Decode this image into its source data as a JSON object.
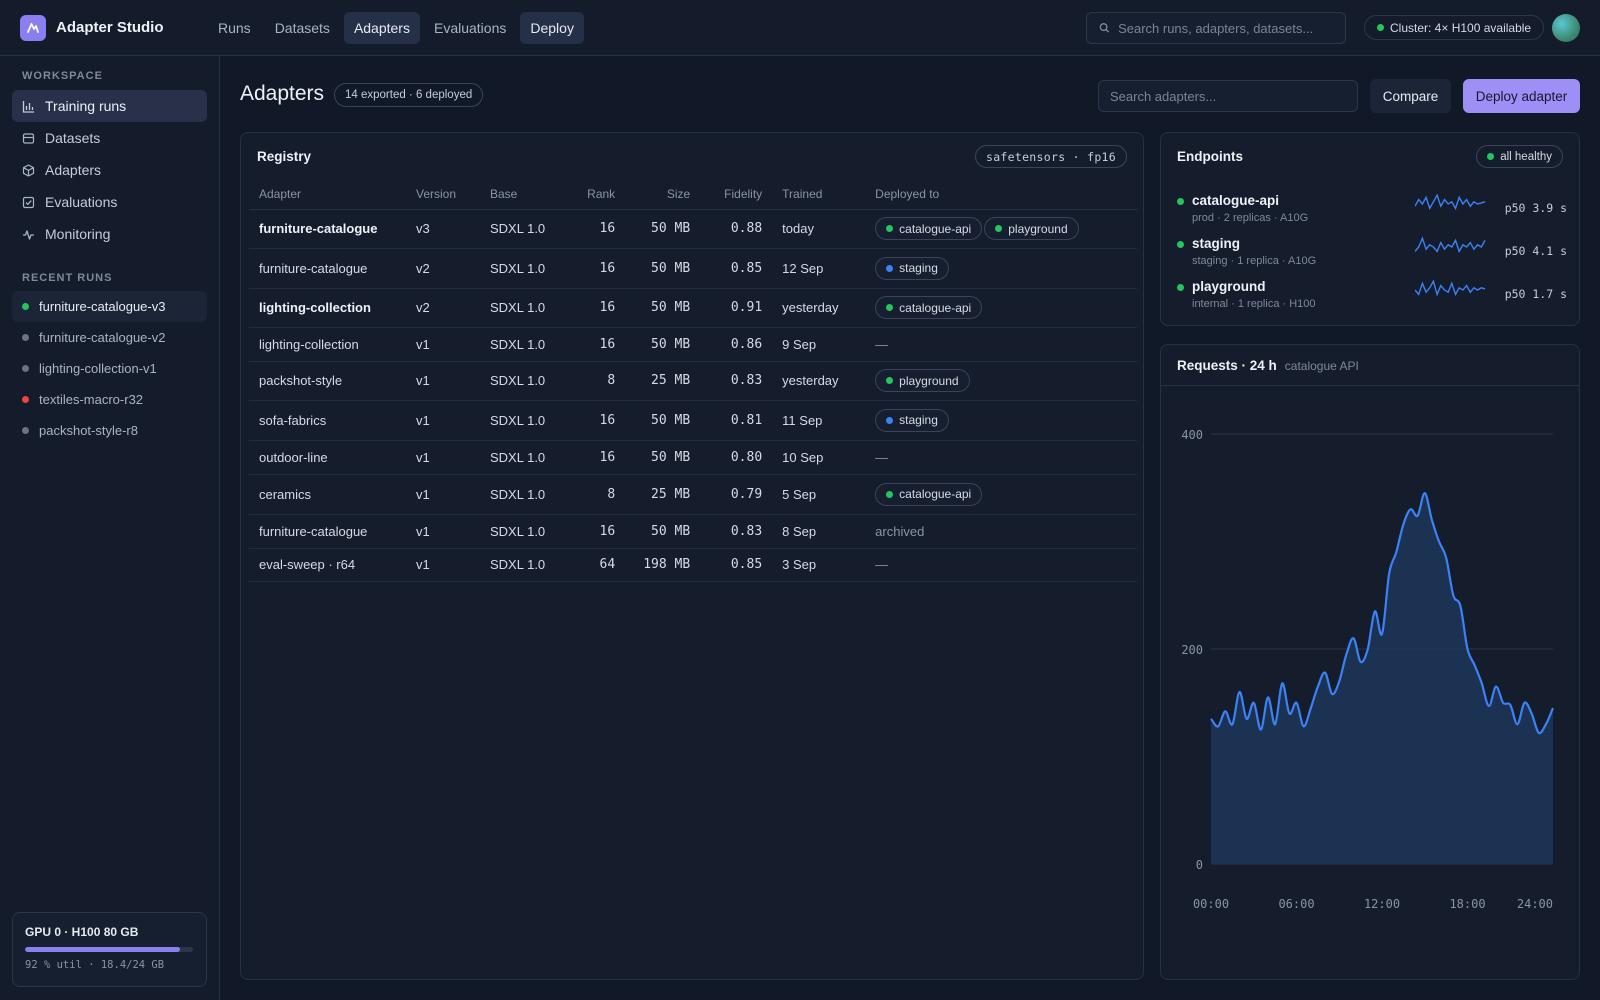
{
  "app": {
    "name": "Adapter Studio"
  },
  "nav": [
    "Runs",
    "Datasets",
    "Adapters",
    "Evaluations",
    "Deploy"
  ],
  "top_search": {
    "placeholder": "Search runs, adapters, datasets..."
  },
  "cluster": {
    "label": "Cluster: 4× H100 available",
    "status_color": "#22c55e"
  },
  "sidebar": {
    "workspace_label": "WORKSPACE",
    "items": [
      {
        "label": "Training runs",
        "icon": "bar-chart-icon"
      },
      {
        "label": "Datasets",
        "icon": "table-icon"
      },
      {
        "label": "Adapters",
        "icon": "cube-icon"
      },
      {
        "label": "Evaluations",
        "icon": "check-square-icon"
      },
      {
        "label": "Monitoring",
        "icon": "pulse-icon"
      }
    ],
    "recent_label": "RECENT RUNS",
    "runs": [
      {
        "name": "furniture-catalogue-v3",
        "status": "running",
        "color": "#22c55e"
      },
      {
        "name": "furniture-catalogue-v2",
        "status": "done",
        "color": "#6b7280"
      },
      {
        "name": "lighting-collection-v1",
        "status": "done",
        "color": "#6b7280"
      },
      {
        "name": "textiles-macro-r32",
        "status": "failed",
        "color": "#ef4444"
      },
      {
        "name": "packshot-style-r8",
        "status": "done",
        "color": "#6b7280"
      }
    ],
    "gpu": {
      "title": "GPU 0 · H100 80 GB",
      "util_fraction": 0.92,
      "meta": "92 % util · 18.4/24 GB"
    }
  },
  "page": {
    "title": "Adapters",
    "count": "14 exported · 6 deployed",
    "search_placeholder": "Search adapters...",
    "compare_label": "Compare",
    "deploy_label": "Deploy adapter"
  },
  "registry": {
    "title": "Registry",
    "format": "safetensors · fp16",
    "columns": [
      "Adapter",
      "Version",
      "Base",
      "Rank",
      "Size",
      "Fidelity",
      "Trained",
      "Deployed to"
    ],
    "rows": [
      {
        "adapter": "furniture-catalogue",
        "version": "v3",
        "base": "SDXL 1.0",
        "rank": "16",
        "size": "50 MB",
        "fidelity": "0.88",
        "trained": "today",
        "deployed": [
          "catalogue-api",
          "playground"
        ],
        "bold": true
      },
      {
        "adapter": "furniture-catalogue",
        "version": "v2",
        "base": "SDXL 1.0",
        "rank": "16",
        "size": "50 MB",
        "fidelity": "0.85",
        "trained": "12 Sep",
        "deployed": [
          "staging"
        ],
        "bold": false
      },
      {
        "adapter": "lighting-collection",
        "version": "v2",
        "base": "SDXL 1.0",
        "rank": "16",
        "size": "50 MB",
        "fidelity": "0.91",
        "trained": "yesterday",
        "deployed": [
          "catalogue-api"
        ],
        "bold": true
      },
      {
        "adapter": "lighting-collection",
        "version": "v1",
        "base": "SDXL 1.0",
        "rank": "16",
        "size": "50 MB",
        "fidelity": "0.86",
        "trained": "9 Sep",
        "deployed_text": "—",
        "bold": false
      },
      {
        "adapter": "packshot-style",
        "version": "v1",
        "base": "SDXL 1.0",
        "rank": "8",
        "size": "25 MB",
        "fidelity": "0.83",
        "trained": "yesterday",
        "deployed": [
          "playground"
        ],
        "bold": false
      },
      {
        "adapter": "sofa-fabrics",
        "version": "v1",
        "base": "SDXL 1.0",
        "rank": "16",
        "size": "50 MB",
        "fidelity": "0.81",
        "trained": "11 Sep",
        "deployed": [
          "staging"
        ],
        "bold": false
      },
      {
        "adapter": "outdoor-line",
        "version": "v1",
        "base": "SDXL 1.0",
        "rank": "16",
        "size": "50 MB",
        "fidelity": "0.80",
        "trained": "10 Sep",
        "deployed_text": "—",
        "bold": false
      },
      {
        "adapter": "ceramics",
        "version": "v1",
        "base": "SDXL 1.0",
        "rank": "8",
        "size": "25 MB",
        "fidelity": "0.79",
        "trained": "5 Sep",
        "deployed": [
          "catalogue-api"
        ],
        "bold": false
      },
      {
        "adapter": "furniture-catalogue",
        "version": "v1",
        "base": "SDXL 1.0",
        "rank": "16",
        "size": "50 MB",
        "fidelity": "0.83",
        "trained": "8 Sep",
        "deployed_text": "archived",
        "bold": false
      },
      {
        "adapter": "eval-sweep · r64",
        "version": "v1",
        "base": "SDXL 1.0",
        "rank": "64",
        "size": "198 MB",
        "fidelity": "0.85",
        "trained": "3 Sep",
        "deployed_text": "—",
        "bold": false
      }
    ],
    "target_colors": {
      "catalogue-api": "#22c55e",
      "playground": "#22c55e",
      "staging": "#3b82f6"
    }
  },
  "endpoints": {
    "title": "Endpoints",
    "status": "all healthy",
    "status_color": "#22c55e",
    "items": [
      {
        "name": "catalogue-api",
        "meta": "prod · 2 replicas · A10G",
        "p50": "p50 3.9 s",
        "color": "#22c55e",
        "spark": [
          0.4,
          0.7,
          0.5,
          0.8,
          0.3,
          0.6,
          0.9,
          0.4,
          0.7,
          0.5,
          0.6,
          0.3,
          0.8,
          0.5,
          0.7,
          0.4,
          0.6,
          0.5,
          0.55,
          0.6
        ]
      },
      {
        "name": "staging",
        "meta": "staging · 1 replica · A10G",
        "p50": "p50 4.1 s",
        "color": "#22c55e",
        "spark": [
          0.3,
          0.5,
          0.9,
          0.4,
          0.6,
          0.5,
          0.3,
          0.7,
          0.4,
          0.6,
          0.5,
          0.8,
          0.3,
          0.6,
          0.5,
          0.7,
          0.4,
          0.6,
          0.5,
          0.8
        ]
      },
      {
        "name": "playground",
        "meta": "internal · 1 replica · H100",
        "p50": "p50 1.7 s",
        "color": "#22c55e",
        "spark": [
          0.5,
          0.3,
          0.8,
          0.4,
          0.6,
          0.9,
          0.3,
          0.7,
          0.5,
          0.4,
          0.8,
          0.3,
          0.6,
          0.5,
          0.7,
          0.4,
          0.6,
          0.5,
          0.6,
          0.55
        ]
      }
    ]
  },
  "requests": {
    "title": "Requests · 24 h",
    "subtitle": "catalogue API",
    "chart_data": {
      "type": "area",
      "x_ticks": [
        "00:00",
        "06:00",
        "12:00",
        "18:00",
        "24:00"
      ],
      "y_ticks": [
        "0",
        "200",
        "400"
      ],
      "ylim": [
        0,
        400
      ],
      "xlim": [
        0,
        24
      ],
      "grid": true,
      "series": [
        {
          "x": [
            0,
            0.5,
            1,
            1.5,
            2,
            2.5,
            3,
            3.5,
            4,
            4.5,
            5,
            5.5,
            6,
            6.5,
            7,
            7.5,
            8,
            8.5,
            9,
            9.5,
            10,
            10.5,
            11,
            11.5,
            12,
            12.5,
            13,
            13.5,
            14,
            14.5,
            15,
            15.5,
            16,
            16.5,
            17,
            17.5,
            18,
            18.5,
            19,
            19.5,
            20,
            20.5,
            21,
            21.5,
            22,
            22.5,
            23,
            23.5,
            24
          ],
          "values": [
            135,
            128,
            142,
            130,
            160,
            135,
            150,
            125,
            155,
            130,
            168,
            140,
            150,
            128,
            145,
            165,
            178,
            158,
            170,
            195,
            210,
            188,
            200,
            235,
            214,
            270,
            290,
            316,
            330,
            324,
            345,
            320,
            300,
            285,
            250,
            240,
            200,
            185,
            168,
            147,
            165,
            150,
            148,
            130,
            150,
            140,
            122,
            130,
            145
          ]
        }
      ]
    }
  }
}
